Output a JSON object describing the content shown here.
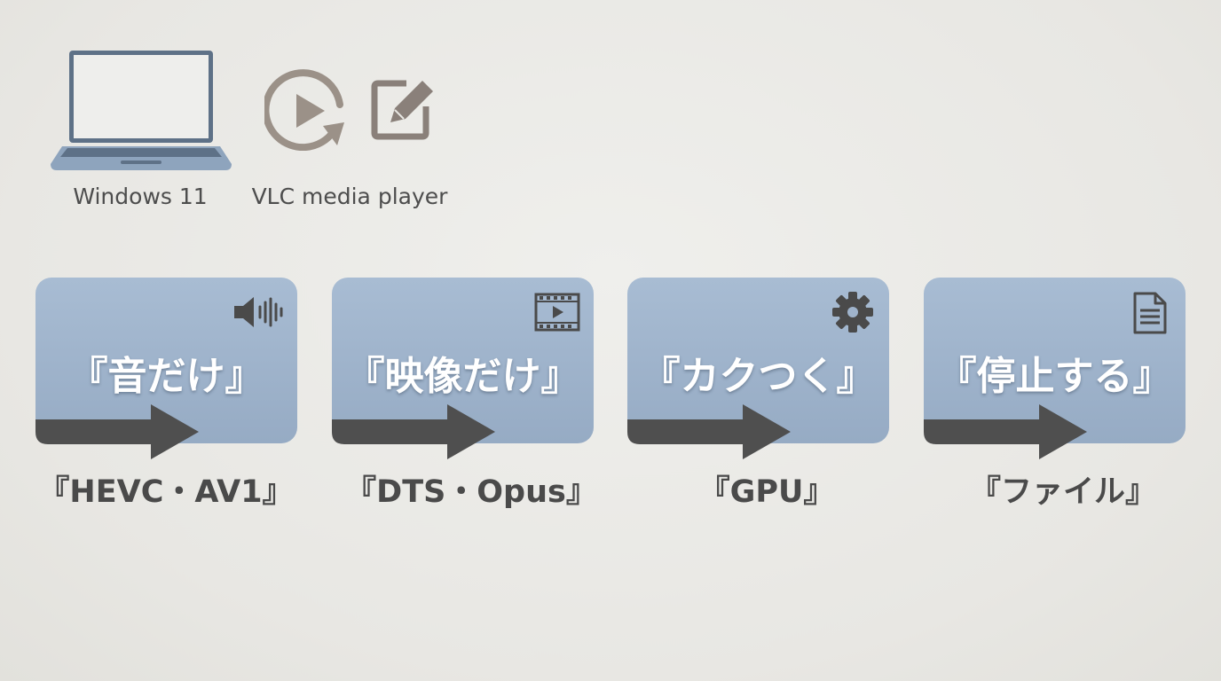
{
  "os": {
    "label": "Windows 11",
    "icon": "laptop-icon"
  },
  "app": {
    "label": "VLC media player",
    "icons": [
      "play-cycle-icon",
      "edit-icon"
    ]
  },
  "cards": [
    {
      "title": "『音だけ』",
      "subtitle": "『HEVC・AV1』",
      "icon": "speaker-icon"
    },
    {
      "title": "『映像だけ』",
      "subtitle": "『DTS・Opus』",
      "icon": "film-icon"
    },
    {
      "title": "『カクつく』",
      "subtitle": "『GPU』",
      "icon": "gear-icon"
    },
    {
      "title": "『停止する』",
      "subtitle": "『ファイル』",
      "icon": "document-icon"
    }
  ],
  "colors": {
    "background": "#e8e7e3",
    "card": "#9fb3cb",
    "arrow": "#4f4f4f",
    "icon_gray": "#9b9188",
    "laptop": "#5e7187",
    "laptop_screen": "#eeeeec",
    "laptop_base": "#8ea4bd"
  }
}
